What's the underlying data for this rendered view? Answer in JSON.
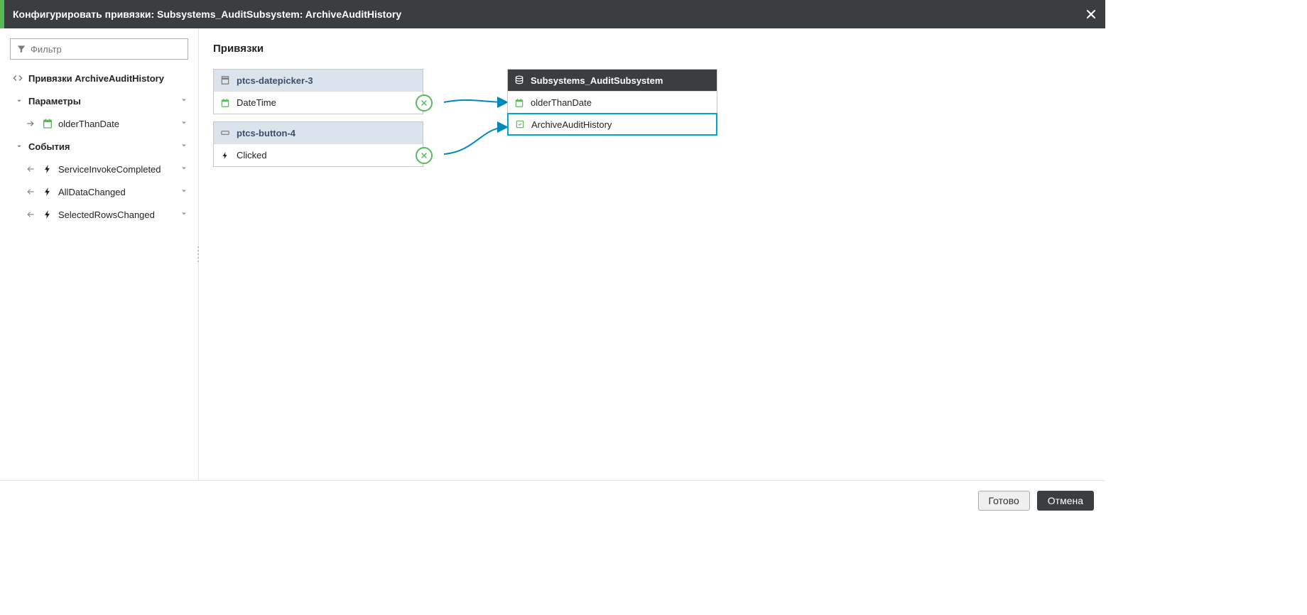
{
  "header": {
    "title": "Конфигурировать привязки: Subsystems_AuditSubsystem: ArchiveAuditHistory"
  },
  "sidebar": {
    "filter_placeholder": "Фильтр",
    "root_label": "Привязки ArchiveAuditHistory",
    "section_params": "Параметры",
    "param_olderThanDate": "olderThanDate",
    "section_events": "События",
    "event_serviceInvokeCompleted": "ServiceInvokeCompleted",
    "event_allDataChanged": "AllDataChanged",
    "event_selectedRowsChanged": "SelectedRowsChanged"
  },
  "canvas": {
    "title": "Привязки",
    "node_datepicker": {
      "name": "ptcs-datepicker-3",
      "port_datetime": "DateTime"
    },
    "node_button": {
      "name": "ptcs-button-4",
      "port_clicked": "Clicked"
    },
    "node_subsystem": {
      "name": "Subsystems_AuditSubsystem",
      "port_olderThanDate": "olderThanDate",
      "port_archiveAuditHistory": "ArchiveAuditHistory"
    }
  },
  "footer": {
    "done": "Готово",
    "cancel": "Отмена"
  }
}
